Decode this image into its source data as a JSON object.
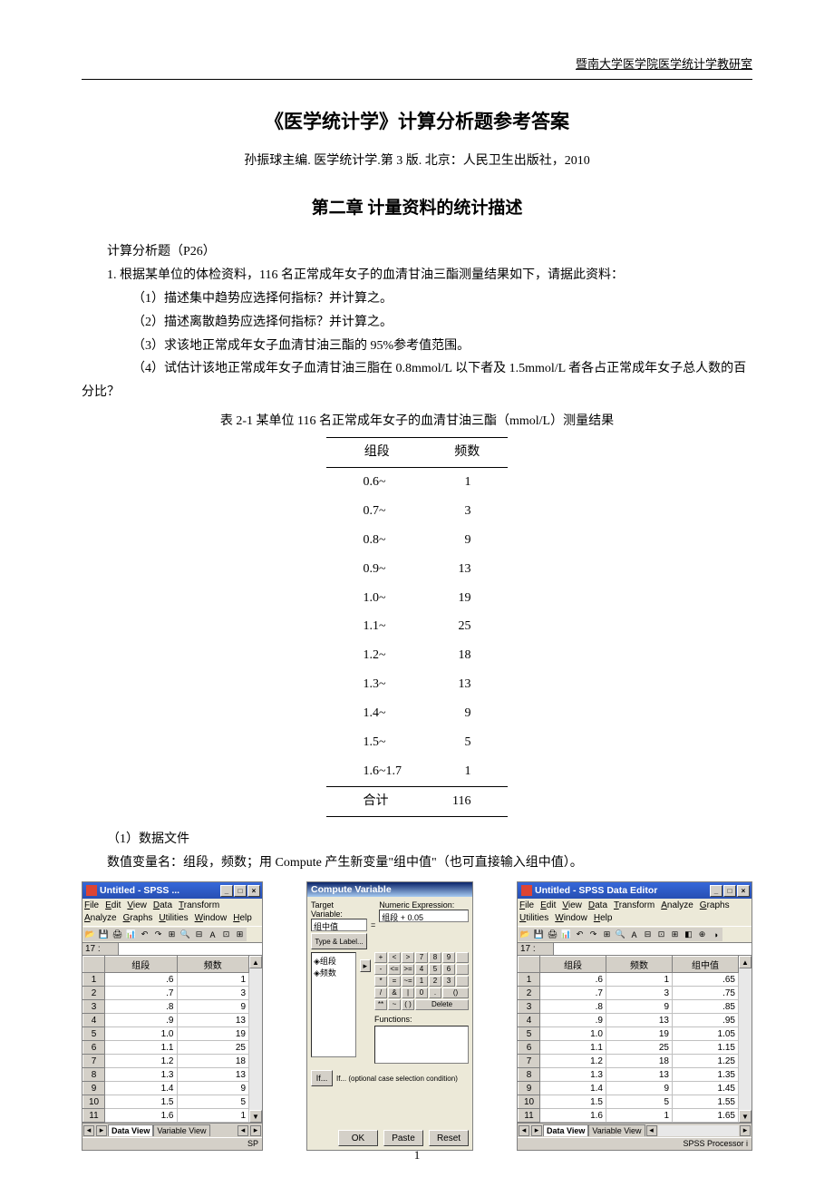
{
  "header": {
    "institution": "暨南大学医学院医学统计学教研室"
  },
  "title": "《医学统计学》计算分析题参考答案",
  "subtitle": "孙振球主编. 医学统计学.第 3 版. 北京：人民卫生出版社，2010",
  "chapter": "第二章  计量资料的统计描述",
  "section_label": "计算分析题（P26）",
  "q1_intro": "1. 根据某单位的体检资料，116 名正常成年女子的血清甘油三酯测量结果如下，请据此资料：",
  "q1_items": {
    "a": "（1）描述集中趋势应选择何指标？并计算之。",
    "b": "（2）描述离散趋势应选择何指标？并计算之。",
    "c": "（3）求该地正常成年女子血清甘油三酯的 95%参考值范围。",
    "d": "（4）试估计该地正常成年女子血清甘油三脂在 0.8mmol/L 以下者及 1.5mmol/L 者各占正常成年女子总人数的百分比？"
  },
  "table": {
    "caption": "表 2-1 某单位 116 名正常成年女子的血清甘油三酯（mmol/L）测量结果",
    "col1": "组段",
    "col2": "频数",
    "rows": [
      {
        "seg": "0.6~",
        "freq": "1"
      },
      {
        "seg": "0.7~",
        "freq": "3"
      },
      {
        "seg": "0.8~",
        "freq": "9"
      },
      {
        "seg": "0.9~",
        "freq": "13"
      },
      {
        "seg": "1.0~",
        "freq": "19"
      },
      {
        "seg": "1.1~",
        "freq": "25"
      },
      {
        "seg": "1.2~",
        "freq": "18"
      },
      {
        "seg": "1.3~",
        "freq": "13"
      },
      {
        "seg": "1.4~",
        "freq": "9"
      },
      {
        "seg": "1.5~",
        "freq": "5"
      },
      {
        "seg": "1.6~1.7",
        "freq": "1"
      }
    ],
    "total_label": "合计",
    "total_value": "116"
  },
  "ans": {
    "head": "（1）数据文件",
    "desc": "数值变量名：组段，频数；用 Compute 产生新变量\"组中值\"（也可直接输入组中值）。"
  },
  "spss1": {
    "title": "Untitled - SPSS ...",
    "menus": [
      "File",
      "Edit",
      "View",
      "Data",
      "Transform",
      "Analyze",
      "Graphs",
      "Utilities",
      "Window",
      "Help"
    ],
    "rownum": "17 :",
    "cols": [
      "组段",
      "频数"
    ],
    "data": [
      [
        ".6",
        "1"
      ],
      [
        ".7",
        "3"
      ],
      [
        ".8",
        "9"
      ],
      [
        ".9",
        "13"
      ],
      [
        "1.0",
        "19"
      ],
      [
        "1.1",
        "25"
      ],
      [
        "1.2",
        "18"
      ],
      [
        "1.3",
        "13"
      ],
      [
        "1.4",
        "9"
      ],
      [
        "1.5",
        "5"
      ],
      [
        "1.6",
        "1"
      ]
    ],
    "tabs": {
      "active": "Data View",
      "inactive": "Variable View"
    },
    "status": "SP"
  },
  "dialog": {
    "title": "Compute Variable",
    "target_label": "Target Variable:",
    "target_value": "组中值",
    "type_label": "Type & Label...",
    "eq": "=",
    "expr_label": "Numeric Expression:",
    "expr_value": "组段 + 0.05",
    "vars": [
      "组段",
      "频数"
    ],
    "func_label": "Functions:",
    "keys": [
      "+",
      "<",
      ">",
      "7",
      "8",
      "9",
      "-",
      "<=",
      ">=",
      "4",
      "5",
      "6",
      "*",
      "=",
      "~=",
      "1",
      "2",
      "3",
      "/",
      "&",
      "|",
      "0",
      ".",
      "()",
      "~",
      "",
      "Delete"
    ],
    "if_label": "If... (optional case selection condition)",
    "buttons": {
      "ok": "OK",
      "paste": "Paste",
      "reset": "Reset"
    }
  },
  "spss3": {
    "title": "Untitled - SPSS Data Editor",
    "menus": [
      "File",
      "Edit",
      "View",
      "Data",
      "Transform",
      "Analyze",
      "Graphs",
      "Utilities",
      "Window",
      "Help"
    ],
    "rownum": "17 :",
    "cols": [
      "组段",
      "频数",
      "组中值"
    ],
    "data": [
      [
        ".6",
        "1",
        ".65"
      ],
      [
        ".7",
        "3",
        ".75"
      ],
      [
        ".8",
        "9",
        ".85"
      ],
      [
        ".9",
        "13",
        ".95"
      ],
      [
        "1.0",
        "19",
        "1.05"
      ],
      [
        "1.1",
        "25",
        "1.15"
      ],
      [
        "1.2",
        "18",
        "1.25"
      ],
      [
        "1.3",
        "13",
        "1.35"
      ],
      [
        "1.4",
        "9",
        "1.45"
      ],
      [
        "1.5",
        "5",
        "1.55"
      ],
      [
        "1.6",
        "1",
        "1.65"
      ]
    ],
    "tabs": {
      "active": "Data View",
      "inactive": "Variable View"
    },
    "status": "SPSS Processor i"
  },
  "page_number": "1"
}
